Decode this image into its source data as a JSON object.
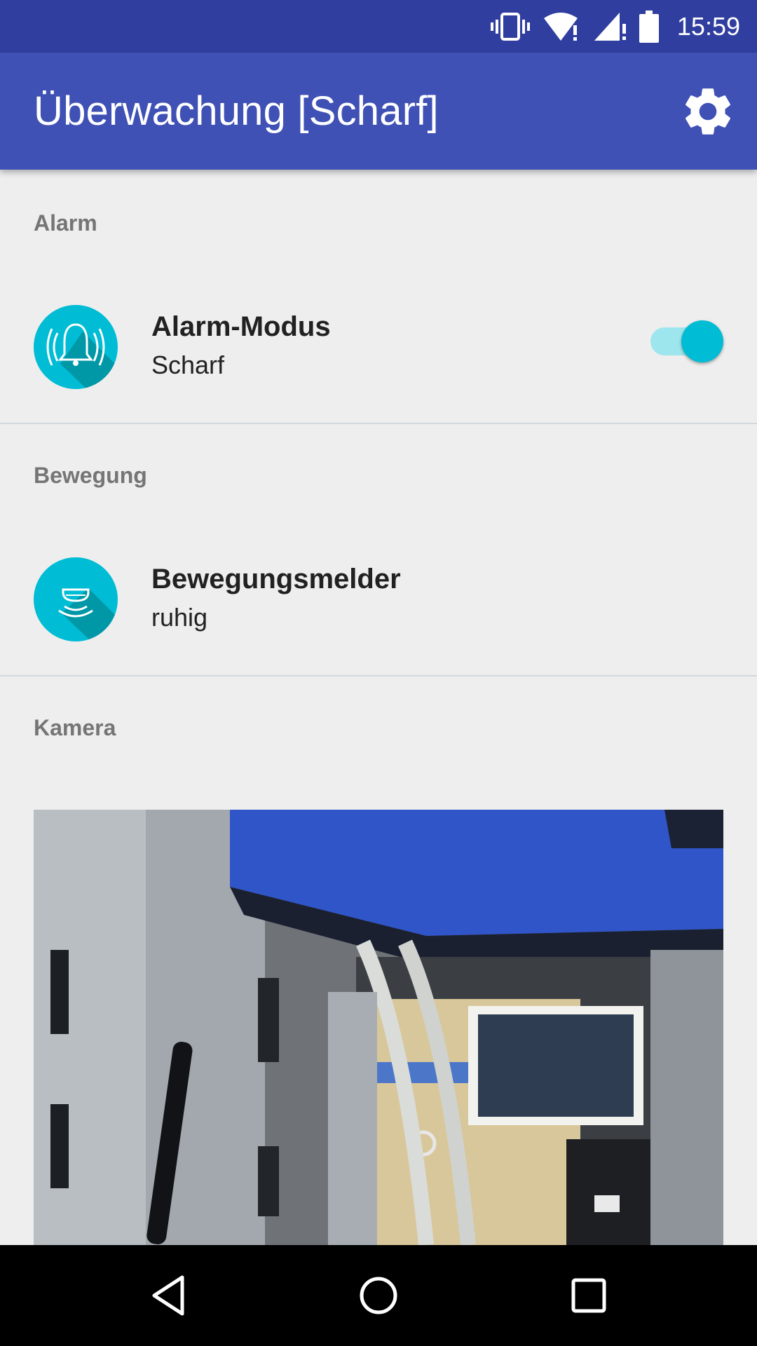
{
  "status_bar": {
    "time": "15:59",
    "icons": [
      "vibrate-icon",
      "wifi-icon",
      "cell-signal-icon",
      "battery-icon"
    ]
  },
  "app_bar": {
    "title": "Überwachung [Scharf]",
    "settings_icon": "gear-icon"
  },
  "sections": {
    "alarm": {
      "header": "Alarm",
      "item": {
        "title": "Alarm-Modus",
        "subtitle": "Scharf",
        "icon": "alarm-bell-icon",
        "toggle_on": true
      }
    },
    "motion": {
      "header": "Bewegung",
      "item": {
        "title": "Bewegungsmelder",
        "subtitle": "ruhig",
        "icon": "motion-sensor-icon"
      }
    },
    "camera": {
      "header": "Kamera"
    }
  },
  "nav_bar": {
    "buttons": [
      "back-icon",
      "home-icon",
      "recents-icon"
    ]
  },
  "colors": {
    "primary": "#3f51b5",
    "primary_dark": "#303f9f",
    "accent": "#00bcd4",
    "background": "#eeeeee"
  }
}
